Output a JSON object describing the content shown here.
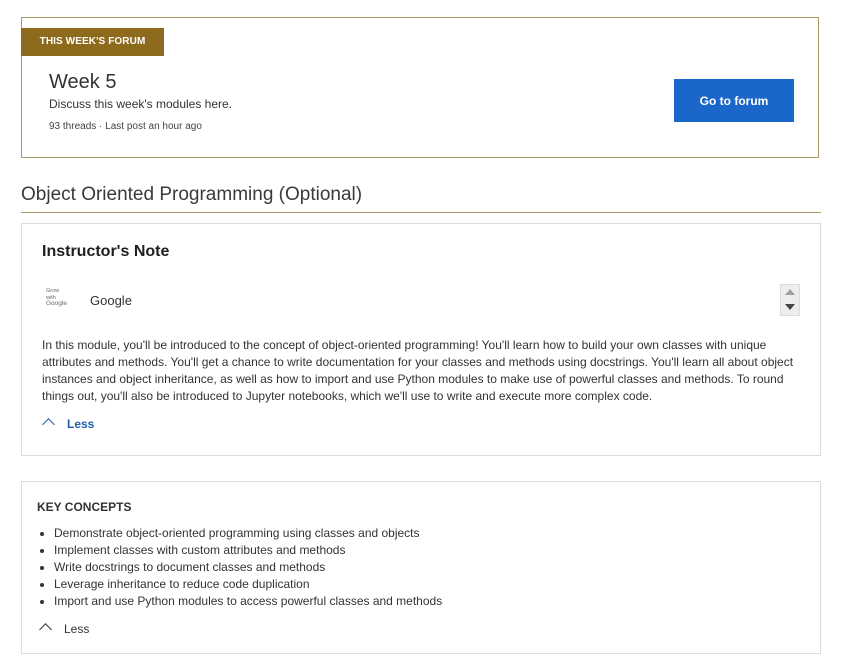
{
  "forum": {
    "tag": "THIS WEEK'S FORUM",
    "title": "Week 5",
    "description": "Discuss this week's modules here.",
    "meta": "93 threads · Last post an hour ago",
    "button_label": "Go to forum"
  },
  "section": {
    "title": "Object Oriented Programming (Optional)"
  },
  "instructor_note": {
    "heading": "Instructor's Note",
    "logo_lines": [
      "Grow",
      "with",
      "Google"
    ],
    "author": "Google",
    "body": "In this module, you'll be introduced to the concept of object-oriented programming! You'll learn how to build your own classes with unique attributes and methods. You'll get a chance to write documentation for your classes and methods using docstrings. You'll learn all about object instances and object inheritance, as well as how to import and use Python modules to make use of powerful classes and methods. To round things out, you'll also be introduced to Jupyter notebooks, which we'll use to write and execute more complex code.",
    "less_label": "Less"
  },
  "key_concepts": {
    "heading": "KEY CONCEPTS",
    "items": [
      "Demonstrate object-oriented programming using classes and objects",
      "Implement classes with custom attributes and methods",
      "Write docstrings to document classes and methods",
      "Leverage inheritance to reduce code duplication",
      "Import and use Python modules to access powerful classes and methods"
    ],
    "less_label": "Less"
  },
  "colors": {
    "tag_bg": "#8e6a1d",
    "button_bg": "#1b66c9",
    "link": "#1f5fae",
    "card_border_gold": "#a89a6a"
  }
}
